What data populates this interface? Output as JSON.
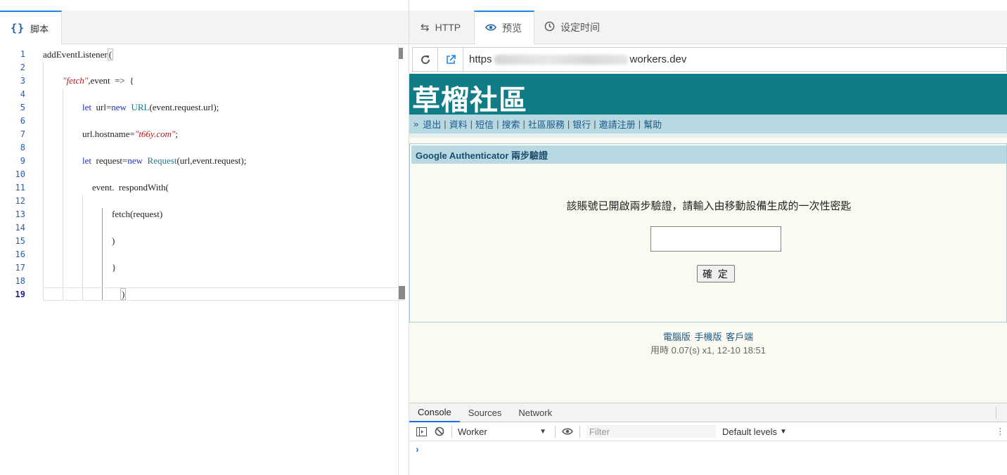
{
  "left_panel": {
    "tab_icon": "{}",
    "tab_label": "脚本",
    "code_lines": [
      {
        "n": "1"
      },
      {
        "n": "2"
      },
      {
        "n": "3"
      },
      {
        "n": "4"
      },
      {
        "n": "5"
      },
      {
        "n": "6"
      },
      {
        "n": "7"
      },
      {
        "n": "8"
      },
      {
        "n": "9"
      },
      {
        "n": "10"
      },
      {
        "n": "11"
      },
      {
        "n": "12"
      },
      {
        "n": "13"
      },
      {
        "n": "14"
      },
      {
        "n": "15"
      },
      {
        "n": "16"
      },
      {
        "n": "17"
      },
      {
        "n": "18"
      },
      {
        "n": "19"
      }
    ],
    "code": {
      "l1_a": "addEventListener",
      "l1_b": "(",
      "l3_str": "\"fetch\"",
      "l3_rest": ",event  =>  {",
      "l5_kw1": "let",
      "l5_a": "  url=",
      "l5_kw2": "new",
      "l5_cls": "  URL",
      "l5_rest": "(event.request.url);",
      "l7_a": "url.hostname=",
      "l7_str": "\"t66y.com\"",
      "l7_end": ";",
      "l9_kw1": "let",
      "l9_a": "  request=",
      "l9_kw2": "new",
      "l9_cls": "  Request",
      "l9_rest": "(url,event.request);",
      "l11": "event.  respondWith(",
      "l13": "fetch(request)",
      "l15": ")",
      "l17": "}",
      "l19": ")"
    },
    "active_line": "19"
  },
  "right_panel": {
    "tabs": [
      {
        "icon": "arrows-swap-icon",
        "glyph": "⇆",
        "label": "HTTP"
      },
      {
        "icon": "eye-icon",
        "glyph": "👁",
        "label": "预览"
      },
      {
        "icon": "clock-icon",
        "glyph": "◷",
        "label": "设定时间"
      }
    ],
    "active_tab": "预览",
    "url": {
      "prefix": "https",
      "suffix": "workers.dev"
    },
    "site": {
      "logo": "草榴社區",
      "nav_arrow": "»",
      "nav_items": [
        "退出",
        "資料",
        "短信",
        "搜索",
        "社區服務",
        "银行",
        "邀請注册",
        "幫助"
      ],
      "auth_title": "Google Authenticator 兩步驗證",
      "auth_message": "該賬號已開啟兩步驗證，請輸入由移動設備生成的一次性密匙",
      "auth_input_value": "",
      "confirm_button": "確 定",
      "footer_links": [
        "電腦版",
        "手機版",
        "客戶端"
      ],
      "footer_time": "用時 0.07(s) x1, 12-10 18:51"
    },
    "console": {
      "tabs": [
        "Console",
        "Sources",
        "Network"
      ],
      "active_tab": "Console",
      "context": "Worker",
      "filter_placeholder": "Filter",
      "levels": "Default levels",
      "prompt": "›"
    }
  },
  "colors": {
    "accent": "#1e88e5",
    "site_header": "#107c86",
    "site_nav": "#b8d8e2",
    "site_bg": "#fafaf0"
  }
}
